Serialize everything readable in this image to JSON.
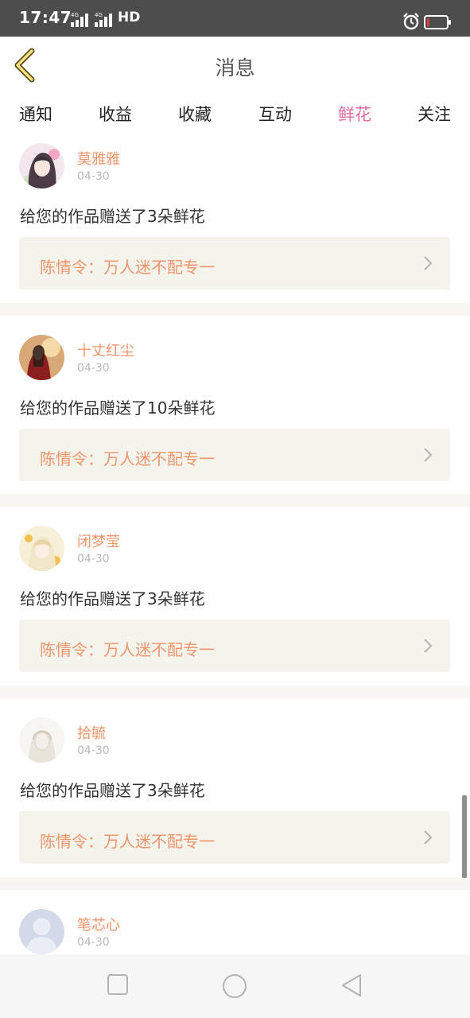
{
  "status_bar": {
    "time": "17:47",
    "signal_1": "4G",
    "signal_2": "4G",
    "hd": "HD",
    "battery_level": 0.1,
    "battery_color": "#e53935"
  },
  "header": {
    "title": "消息",
    "back_icon": "chevron-left-icon"
  },
  "tabs": [
    {
      "label": "通知",
      "active": false
    },
    {
      "label": "收益",
      "active": false
    },
    {
      "label": "收藏",
      "active": false
    },
    {
      "label": "互动",
      "active": false
    },
    {
      "label": "鲜花",
      "active": true
    },
    {
      "label": "关注",
      "active": false
    }
  ],
  "accent_color": "#e56aa5",
  "name_color": "#f0956a",
  "messages": [
    {
      "user": "莫雅雅",
      "date": "04-30",
      "text": "给您的作品赠送了3朵鲜花",
      "work_title": "陈情令：万人迷不配专一"
    },
    {
      "user": "十丈红尘",
      "date": "04-30",
      "text": "给您的作品赠送了10朵鲜花",
      "work_title": "陈情令：万人迷不配专一"
    },
    {
      "user": "闭梦莹",
      "date": "04-30",
      "text": "给您的作品赠送了3朵鲜花",
      "work_title": "陈情令：万人迷不配专一"
    },
    {
      "user": "拾毓",
      "date": "04-30",
      "text": "给您的作品赠送了3朵鲜花",
      "work_title": "陈情令：万人迷不配专一"
    },
    {
      "user": "笔芯心",
      "date": "04-30",
      "text": "",
      "work_title": ""
    }
  ],
  "nav_bar": {
    "recent_icon": "square-icon",
    "home_icon": "circle-icon",
    "back_icon": "triangle-back-icon"
  }
}
